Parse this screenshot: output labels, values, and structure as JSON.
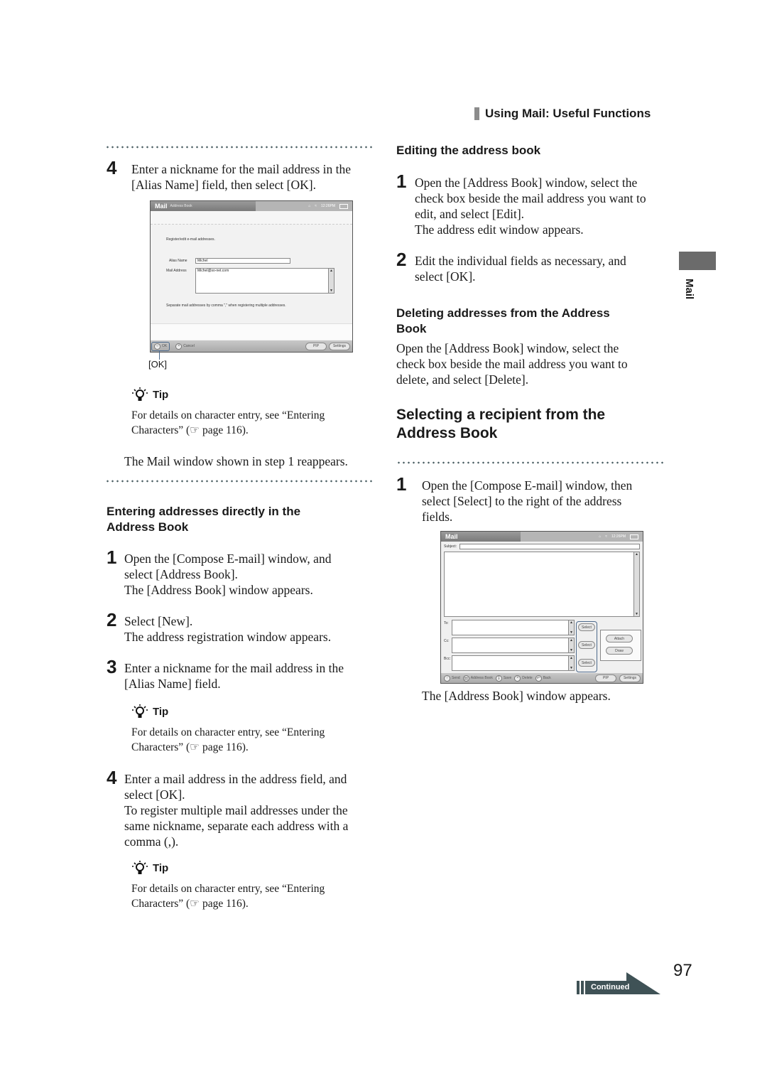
{
  "running_head": "Using Mail: Useful Functions",
  "side_tab_label": "Mail",
  "page_number": "97",
  "continued_label": "Continued",
  "left_column": {
    "step4_top": {
      "number": "4",
      "text": "Enter a nickname for the mail address in the [Alias Name] field, then select [OK]."
    },
    "screenshot1": {
      "app_title": "Mail",
      "window_subtitle": "Address Book",
      "status_text": "12:26PM",
      "instruction": "Register/edit e-mail addresses.",
      "alias_label": "Alias Name",
      "alias_value": "Michel",
      "address_label": "Mail Address",
      "address_value": "Michel@so-net.com",
      "note": "Separate mail addresses by comma \",\" when registering multiple addresses.",
      "ok_button": "OK",
      "cancel_button": "Cancel",
      "pip_button": "PIP",
      "settings_button": "Settings",
      "callout": "[OK]"
    },
    "tip1": {
      "title": "Tip",
      "text_line1": "For details on character entry, see “Entering",
      "text_line2": "Characters” (☞ page 116)."
    },
    "after_tip_text": "The Mail window shown in step 1 reappears.",
    "section_heading": "Entering addresses directly in the Address Book",
    "steps": [
      {
        "number": "1",
        "lines": [
          "Open the [Compose E-mail] window, and",
          "select [Address Book].",
          "The [Address Book] window appears."
        ]
      },
      {
        "number": "2",
        "lines": [
          "Select [New].",
          "The address registration window appears."
        ]
      },
      {
        "number": "3",
        "lines": [
          "Enter a nickname for the mail address in the",
          "[Alias Name] field."
        ]
      },
      {
        "number": "4",
        "lines": [
          "Enter a mail address in the address field, and",
          "select [OK].",
          "To register multiple mail addresses under the",
          "same nickname, separate each address with a",
          "comma (,)."
        ]
      }
    ],
    "tip2": {
      "title": "Tip",
      "text_line1": "For details on character entry, see “Entering",
      "text_line2": "Characters” (☞ page 116)."
    },
    "tip3": {
      "title": "Tip",
      "text_line1": "For details on character entry, see “Entering",
      "text_line2": "Characters” (☞ page 116)."
    }
  },
  "right_column": {
    "editing_heading": "Editing the address book",
    "editing_steps": [
      {
        "number": "1",
        "lines": [
          "Open the [Address Book] window, select the",
          "check box beside the mail address you want to",
          "edit, and select [Edit].",
          "The address edit window appears."
        ]
      },
      {
        "number": "2",
        "lines": [
          "Edit the individual fields as necessary, and",
          "select [OK]."
        ]
      }
    ],
    "deleting_heading_line1": "Deleting addresses from the Address",
    "deleting_heading_line2": "Book",
    "deleting_text": [
      "Open the [Address Book] window, select the",
      "check box beside the mail address you want to",
      "delete, and select [Delete]."
    ],
    "selecting_heading_line1": "Selecting a recipient from the",
    "selecting_heading_line2": "Address Book",
    "selecting_step": {
      "number": "1",
      "lines": [
        "Open the [Compose E-mail] window, then",
        "select [Select] to the right of the address",
        "fields."
      ]
    },
    "screenshot2": {
      "app_title": "Mail",
      "status_text": "12:26PM",
      "subject_label": "Subject:",
      "to_label": "To:",
      "cc_label": "Cc:",
      "bcc_label": "Bcc:",
      "select_button": "Select",
      "attach_button": "Attach",
      "draw_button": "Draw",
      "toolbar": [
        "Send",
        "Address Book",
        "Save",
        "Delete",
        "Back"
      ],
      "pip_button": "PIP",
      "settings_button": "Settings"
    },
    "after_text": "The [Address Book] window appears."
  }
}
